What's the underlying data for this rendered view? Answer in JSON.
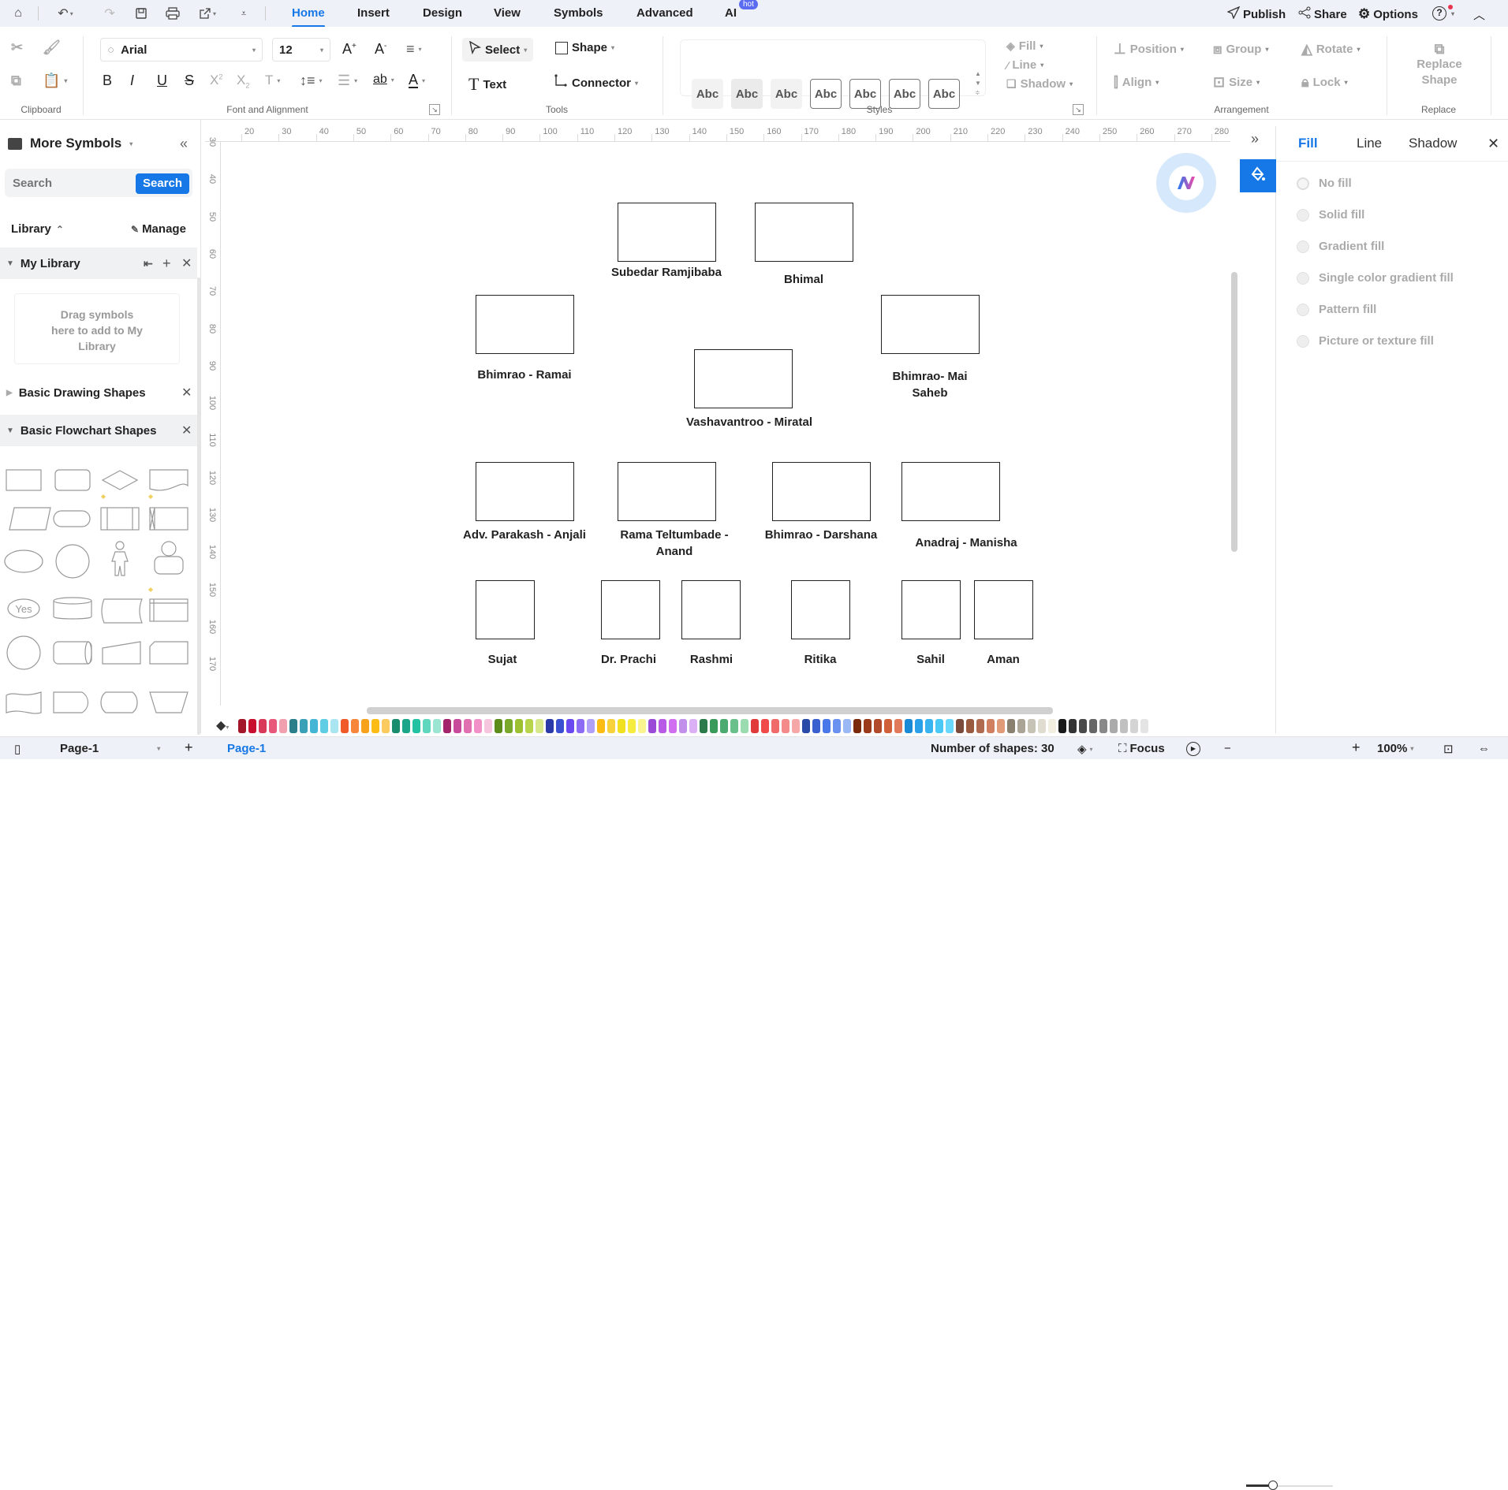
{
  "menubar": {
    "tabs": [
      "Home",
      "Insert",
      "Design",
      "View",
      "Symbols",
      "Advanced",
      "AI"
    ],
    "active_tab": "Home",
    "ai_badge": "hot",
    "right": {
      "publish": "Publish",
      "share": "Share",
      "options": "Options"
    },
    "icons": [
      "home-icon",
      "undo-icon",
      "redo-icon",
      "save-icon",
      "print-icon",
      "export-icon",
      "more-icon"
    ]
  },
  "ribbon": {
    "clipboard": {
      "label": "Clipboard"
    },
    "font": {
      "family": "Arial",
      "size": "12",
      "label": "Font and Alignment"
    },
    "tools": {
      "select": "Select",
      "shape": "Shape",
      "text": "Text",
      "connector": "Connector",
      "label": "Tools"
    },
    "styles": {
      "swatches": [
        "Abc",
        "Abc",
        "Abc",
        "Abc",
        "Abc",
        "Abc",
        "Abc"
      ],
      "fill": "Fill",
      "line": "Line",
      "shadow": "Shadow",
      "label": "Styles"
    },
    "arrangement": {
      "position": "Position",
      "group": "Group",
      "rotate": "Rotate",
      "align": "Align",
      "size": "Size",
      "lock": "Lock",
      "label": "Arrangement"
    },
    "replace": {
      "button": "Replace Shape",
      "label": "Replace"
    }
  },
  "left_panel": {
    "title": "More Symbols",
    "search_placeholder": "Search",
    "search_button": "Search",
    "library_label": "Library",
    "manage_label": "Manage",
    "sections": [
      {
        "name": "My Library",
        "expanded": true
      },
      {
        "name": "Basic Drawing Shapes",
        "expanded": false
      },
      {
        "name": "Basic Flowchart Shapes",
        "expanded": true
      }
    ],
    "drop_hint": "Drag symbols here to add to My Library",
    "yes_shape_text": "Yes"
  },
  "rulers": {
    "horizontal": [
      "20",
      "30",
      "40",
      "50",
      "60",
      "70",
      "80",
      "90",
      "100",
      "110",
      "120",
      "130",
      "140",
      "150",
      "160",
      "170",
      "180",
      "190",
      "200",
      "210",
      "220",
      "230",
      "240",
      "250",
      "260",
      "270",
      "280"
    ],
    "vertical": [
      "30",
      "40",
      "50",
      "60",
      "70",
      "80",
      "90",
      "100",
      "110",
      "120",
      "130",
      "140",
      "150",
      "160",
      "170"
    ]
  },
  "diagram": {
    "nodes": [
      {
        "id": "subedar",
        "label": "Subedar Ramjibaba"
      },
      {
        "id": "bhimal",
        "label": "Bhimal"
      },
      {
        "id": "bhimrao-ramai",
        "label": "Bhimrao - Ramai"
      },
      {
        "id": "bhimrao-maisaheb",
        "label": "Bhimrao- Mai Saheb"
      },
      {
        "id": "vashavantroo",
        "label": "Vashavantroo - Miratal"
      },
      {
        "id": "parakash",
        "label": "Adv. Parakash - Anjali"
      },
      {
        "id": "rama",
        "label": "Rama Teltumbade - Anand"
      },
      {
        "id": "bhimrao-darshana",
        "label": "Bhimrao - Darshana"
      },
      {
        "id": "anadraj",
        "label": "Anadraj - Manisha"
      },
      {
        "id": "sujat",
        "label": "Sujat"
      },
      {
        "id": "prachi",
        "label": "Dr. Prachi"
      },
      {
        "id": "rashmi",
        "label": "Rashmi"
      },
      {
        "id": "ritika",
        "label": "Ritika"
      },
      {
        "id": "sahil",
        "label": "Sahil"
      },
      {
        "id": "aman",
        "label": "Aman"
      }
    ]
  },
  "palette": [
    "#a3162a",
    "#c8102e",
    "#d93a5a",
    "#e8587a",
    "#f1a0b0",
    "#2a7f8a",
    "#3aa0b8",
    "#45b5d6",
    "#5fcde4",
    "#aae6f2",
    "#f05a28",
    "#f7863a",
    "#f7a21b",
    "#fbbd15",
    "#fbcb60",
    "#1a8c6e",
    "#1ba68a",
    "#22c2a2",
    "#5fd6be",
    "#9ae6d2",
    "#a3246a",
    "#c84a9a",
    "#e070b0",
    "#f290c8",
    "#f6c6de",
    "#5e8c1a",
    "#7aa82a",
    "#9cc030",
    "#b8d44a",
    "#d6e88a",
    "#2a3aa8",
    "#3a50d0",
    "#6a4af0",
    "#8c6cf4",
    "#b0a0f8",
    "#fbbd15",
    "#f7d23a",
    "#f0e020",
    "#f6ec40",
    "#faf490",
    "#9a4ad6",
    "#b85ae6",
    "#d070f0",
    "#c090ea",
    "#dcb0f4",
    "#2a7a4a",
    "#3a9a5a",
    "#4aaa70",
    "#6ac08a",
    "#9adcb0",
    "#e03a3a",
    "#f04a4a",
    "#f06a6a",
    "#f48a8a",
    "#f6a8a8",
    "#2a4aa8",
    "#3a60d0",
    "#4a78e8",
    "#6a90f0",
    "#9ab8f6",
    "#7a2a0a",
    "#9a3a1a",
    "#b04a2a",
    "#d0603a",
    "#e07a5a",
    "#1a8ad6",
    "#2aa0e8",
    "#3ab4f0",
    "#4ac8f6",
    "#6ad8fa",
    "#7a4a3a",
    "#9a5a40",
    "#b06a50",
    "#d08060",
    "#e09a78",
    "#8a8070",
    "#aaa496",
    "#c6c2b4",
    "#e0ddd0",
    "#f2eee0",
    "#1a1a1a",
    "#333333",
    "#4a4a4a",
    "#666666",
    "#888888",
    "#aaaaaa",
    "#c0c0c0",
    "#d4d4d4",
    "#e4e4e4"
  ],
  "right_panel": {
    "tabs": [
      "Fill",
      "Line",
      "Shadow"
    ],
    "active_tab": "Fill",
    "fill_options": [
      "No fill",
      "Solid fill",
      "Gradient fill",
      "Single color gradient fill",
      "Pattern fill",
      "Picture or texture fill"
    ]
  },
  "status": {
    "page_selector": "Page-1",
    "page_tab": "Page-1",
    "shape_count": "Number of shapes: 30",
    "focus": "Focus",
    "zoom": "100%"
  },
  "colors": {
    "accent": "#1677e6",
    "menubar_bg": "#eef1f7"
  }
}
